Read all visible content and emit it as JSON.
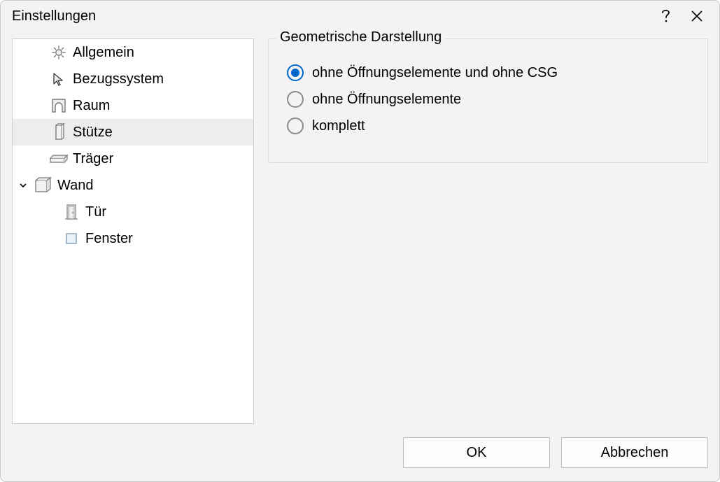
{
  "title": "Einstellungen",
  "tree": {
    "items": [
      {
        "label": "Allgemein",
        "icon": "gear-icon",
        "indent": 0,
        "chevron": null,
        "selected": false
      },
      {
        "label": "Bezugssystem",
        "icon": "cursor-icon",
        "indent": 0,
        "chevron": null,
        "selected": false
      },
      {
        "label": "Raum",
        "icon": "room-icon",
        "indent": 0,
        "chevron": null,
        "selected": false
      },
      {
        "label": "Stütze",
        "icon": "column-icon",
        "indent": 0,
        "chevron": null,
        "selected": true
      },
      {
        "label": "Träger",
        "icon": "beam-icon",
        "indent": 0,
        "chevron": null,
        "selected": false
      },
      {
        "label": "Wand",
        "icon": "wall-icon",
        "indent": 0,
        "chevron": "down",
        "selected": false
      },
      {
        "label": "Tür",
        "icon": "door-icon",
        "indent": 1,
        "chevron": null,
        "selected": false
      },
      {
        "label": "Fenster",
        "icon": "window-icon",
        "indent": 1,
        "chevron": null,
        "selected": false
      }
    ]
  },
  "group": {
    "title": "Geometrische Darstellung",
    "options": [
      {
        "label": "ohne Öffnungselemente und ohne CSG",
        "checked": true
      },
      {
        "label": "ohne Öffnungselemente",
        "checked": false
      },
      {
        "label": "komplett",
        "checked": false
      }
    ]
  },
  "buttons": {
    "ok": "OK",
    "cancel": "Abbrechen"
  }
}
